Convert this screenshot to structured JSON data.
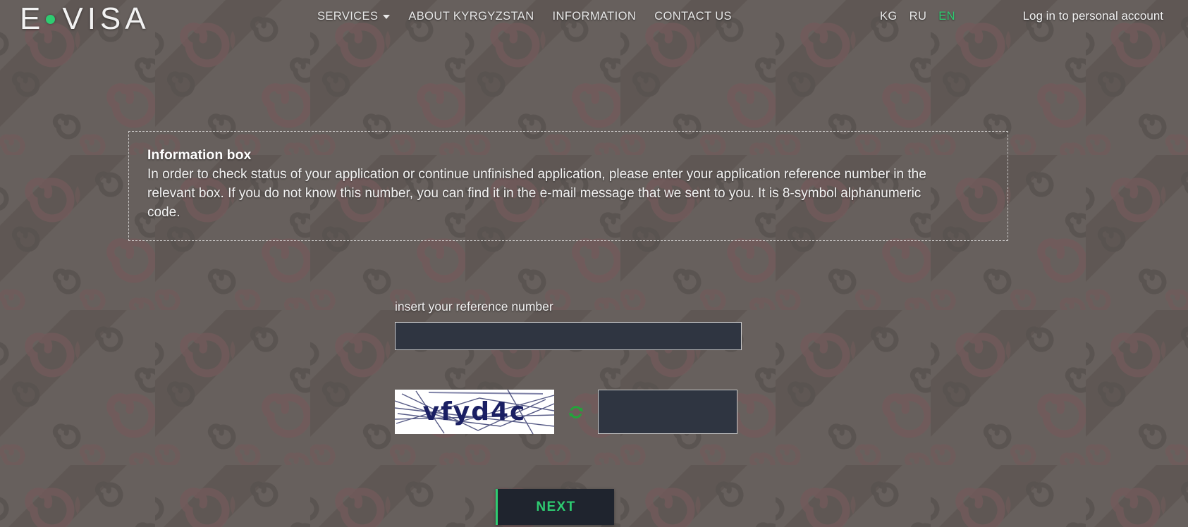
{
  "header": {
    "logo": {
      "letter": "E",
      "word": "VISA",
      "dot_color": "#2ecc71"
    },
    "nav": [
      {
        "label": "SERVICES",
        "has_caret": true
      },
      {
        "label": "ABOUT KYRGYZSTAN",
        "has_caret": false
      },
      {
        "label": "INFORMATION",
        "has_caret": false
      },
      {
        "label": "CONTACT US",
        "has_caret": false
      }
    ],
    "languages": [
      {
        "code": "KG",
        "active": false
      },
      {
        "code": "RU",
        "active": false
      },
      {
        "code": "EN",
        "active": true
      }
    ],
    "login_label": "Log in to personal account"
  },
  "info_box": {
    "title": "Information box",
    "text": "In order to check status of your application or continue unfinished application, please enter your application reference number in the relevant box. If you do not know this number, you can find it in the e-mail message that we sent to you. It is 8-symbol alphanumeric code."
  },
  "form": {
    "reference_label": "insert your reference number",
    "reference_value": "",
    "reference_placeholder": "",
    "captcha_text": "vfyd4c",
    "captcha_input_value": "",
    "captcha_input_placeholder": "",
    "refresh_icon": "refresh-icon",
    "next_label": "NEXT"
  },
  "colors": {
    "accent_green": "#2ecc71",
    "input_background": "#2f3541",
    "page_background": "#6b6360",
    "pattern_grey": "#5f5754",
    "pattern_maroon": "#7a5a5d",
    "captcha_ink": "#1a1f63"
  }
}
